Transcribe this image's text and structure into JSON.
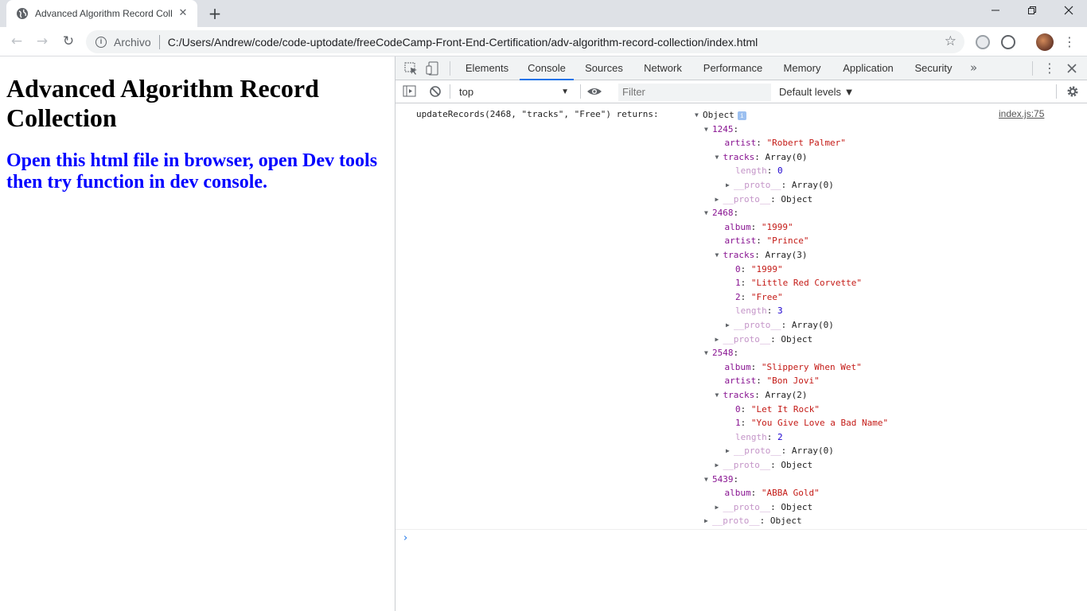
{
  "browser": {
    "tab_title": "Advanced Algorithm Record Collection",
    "tab_close": "✕",
    "new_tab": "+",
    "window_controls": {
      "minimize": "—",
      "restore": "❐",
      "close": "✕"
    },
    "security_label": "Archivo",
    "url": "C:/Users/Andrew/code/code-uptodate/freeCodeCamp-Front-End-Certification/adv-algorithm-record-collection/index.html",
    "back": "←",
    "forward": "→",
    "reload": "↻",
    "star": "☆",
    "menu": "⋮"
  },
  "page": {
    "heading": "Advanced Algorithm Record Collection",
    "subheading": "Open this html file in browser, open Dev tools then try function in dev console."
  },
  "devtools": {
    "tabs": [
      {
        "label": "Elements"
      },
      {
        "label": "Console"
      },
      {
        "label": "Sources"
      },
      {
        "label": "Network"
      },
      {
        "label": "Performance"
      },
      {
        "label": "Memory"
      },
      {
        "label": "Application"
      },
      {
        "label": "Security"
      }
    ],
    "more": "»",
    "context": "top",
    "filter_placeholder": "Filter",
    "levels": "Default levels ▼",
    "source_link": "index.js:75",
    "message_label": "updateRecords(2468, \"tracks\", \"Free\") returns:",
    "object_label": "Object",
    "info_badge": "i",
    "prompt": "›",
    "tree": [
      {
        "k": "1245",
        "v": ""
      },
      {
        "k": "artist",
        "v": "\"Robert Palmer\""
      },
      {
        "k": "tracks",
        "v": "Array(0)"
      },
      {
        "k": "length",
        "v": "0"
      },
      {
        "k": "__proto__",
        "v": "Array(0)"
      },
      {
        "k": "__proto__",
        "v": "Object"
      },
      {
        "k": "2468",
        "v": ""
      },
      {
        "k": "album",
        "v": "\"1999\""
      },
      {
        "k": "artist",
        "v": "\"Prince\""
      },
      {
        "k": "tracks",
        "v": "Array(3)"
      },
      {
        "k": "0",
        "v": "\"1999\""
      },
      {
        "k": "1",
        "v": "\"Little Red Corvette\""
      },
      {
        "k": "2",
        "v": "\"Free\""
      },
      {
        "k": "length",
        "v": "3"
      },
      {
        "k": "__proto__",
        "v": "Array(0)"
      },
      {
        "k": "__proto__",
        "v": "Object"
      },
      {
        "k": "2548",
        "v": ""
      },
      {
        "k": "album",
        "v": "\"Slippery When Wet\""
      },
      {
        "k": "artist",
        "v": "\"Bon Jovi\""
      },
      {
        "k": "tracks",
        "v": "Array(2)"
      },
      {
        "k": "0",
        "v": "\"Let It Rock\""
      },
      {
        "k": "1",
        "v": "\"You Give Love a Bad Name\""
      },
      {
        "k": "length",
        "v": "2"
      },
      {
        "k": "__proto__",
        "v": "Array(0)"
      },
      {
        "k": "__proto__",
        "v": "Object"
      },
      {
        "k": "5439",
        "v": ""
      },
      {
        "k": "album",
        "v": "\"ABBA Gold\""
      },
      {
        "k": "__proto__",
        "v": "Object"
      },
      {
        "k": "__proto__",
        "v": "Object"
      }
    ]
  }
}
